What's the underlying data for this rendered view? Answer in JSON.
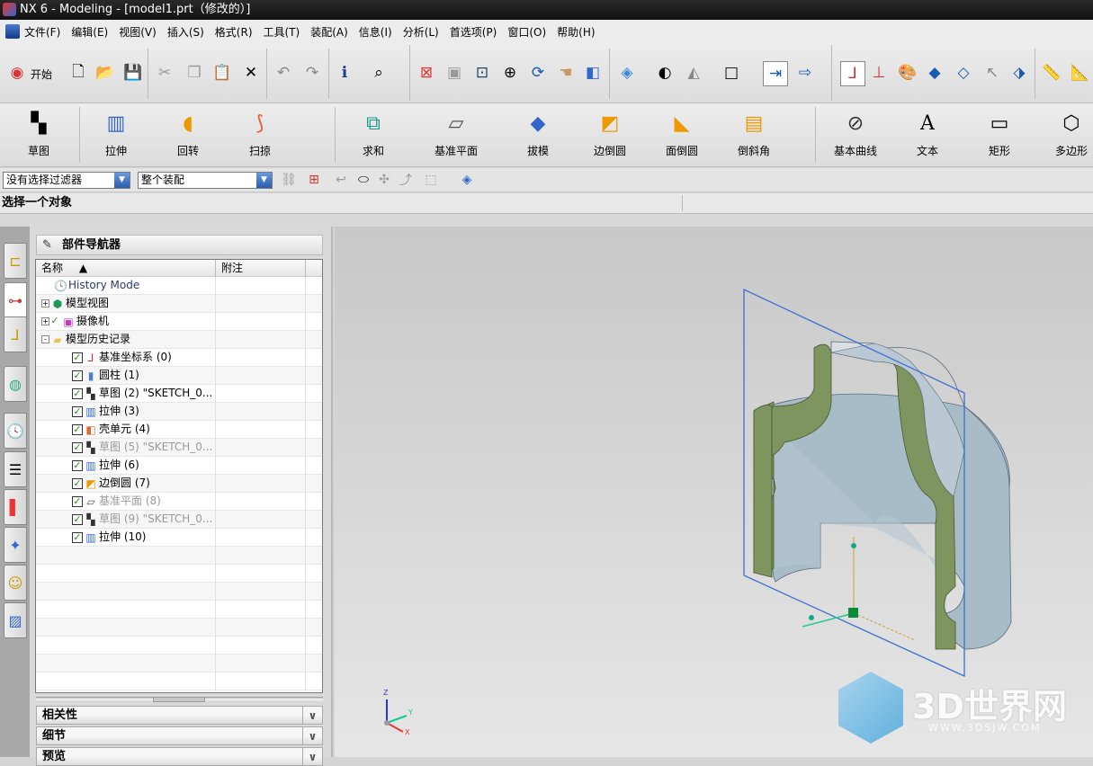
{
  "window": {
    "title": "NX 6 - Modeling - [model1.prt（修改的）]"
  },
  "menu": [
    "文件(F)",
    "编辑(E)",
    "视图(V)",
    "插入(S)",
    "格式(R)",
    "工具(T)",
    "装配(A)",
    "信息(I)",
    "分析(L)",
    "首选项(P)",
    "窗口(O)",
    "帮助(H)"
  ],
  "toolbar": {
    "start_label": "开始"
  },
  "features": {
    "sketch": "草图",
    "extrude": "拉伸",
    "revolve": "回转",
    "sweep": "扫掠",
    "unite": "求和",
    "datum_plane": "基准平面",
    "draft": "拔模",
    "edge_blend": "边倒圆",
    "face_blend": "面倒圆",
    "chamfer": "倒斜角",
    "basic_curves": "基本曲线",
    "text": "文本",
    "rectangle": "矩形",
    "polygon": "多边形"
  },
  "selection": {
    "filter": "没有选择过滤器",
    "scope": "整个装配"
  },
  "status": {
    "prompt": "选择一个对象"
  },
  "navigator": {
    "title": "部件导航器",
    "columns": [
      "名称",
      "附注"
    ],
    "rows": [
      {
        "label": "History Mode",
        "icon": "clock",
        "level": 0
      },
      {
        "label": "模型视图",
        "icon": "model-view",
        "level": 0,
        "expand": "+"
      },
      {
        "label": "摄像机",
        "icon": "camera",
        "level": 0,
        "expand": "+",
        "checked": true
      },
      {
        "label": "模型历史记录",
        "icon": "folder",
        "level": 0,
        "expand": "-"
      },
      {
        "label": "基准坐标系 (0)",
        "icon": "datum-csys",
        "level": 1,
        "checked": true
      },
      {
        "label": "圆柱 (1)",
        "icon": "cylinder",
        "level": 1,
        "checked": true
      },
      {
        "label": "草图 (2) \"SKETCH_0...",
        "icon": "sketch",
        "level": 1,
        "checked": true
      },
      {
        "label": "拉伸 (3)",
        "icon": "extrude",
        "level": 1,
        "checked": true
      },
      {
        "label": "壳单元 (4)",
        "icon": "shell",
        "level": 1,
        "checked": true
      },
      {
        "label": "草图 (5) \"SKETCH_0...",
        "icon": "sketch",
        "level": 1,
        "checked": true,
        "dim": true
      },
      {
        "label": "拉伸 (6)",
        "icon": "extrude",
        "level": 1,
        "checked": true
      },
      {
        "label": "边倒圆 (7)",
        "icon": "edge-blend",
        "level": 1,
        "checked": true
      },
      {
        "label": "基准平面 (8)",
        "icon": "datum-plane",
        "level": 1,
        "checked": true,
        "dim": true
      },
      {
        "label": "草图 (9) \"SKETCH_0...",
        "icon": "sketch",
        "level": 1,
        "checked": true,
        "dim": true
      },
      {
        "label": "拉伸 (10)",
        "icon": "extrude",
        "level": 1,
        "checked": true
      }
    ]
  },
  "panels": [
    "相关性",
    "细节",
    "预览"
  ],
  "triad": {
    "x": "X",
    "y": "Y",
    "z": "Z"
  },
  "watermark": {
    "brand": "3D世界网",
    "url": "WWW.3DSJW.COM"
  },
  "colors": {
    "face": "#a9bcc8",
    "section": "#7f955f",
    "plane": "#3b6fd1"
  }
}
